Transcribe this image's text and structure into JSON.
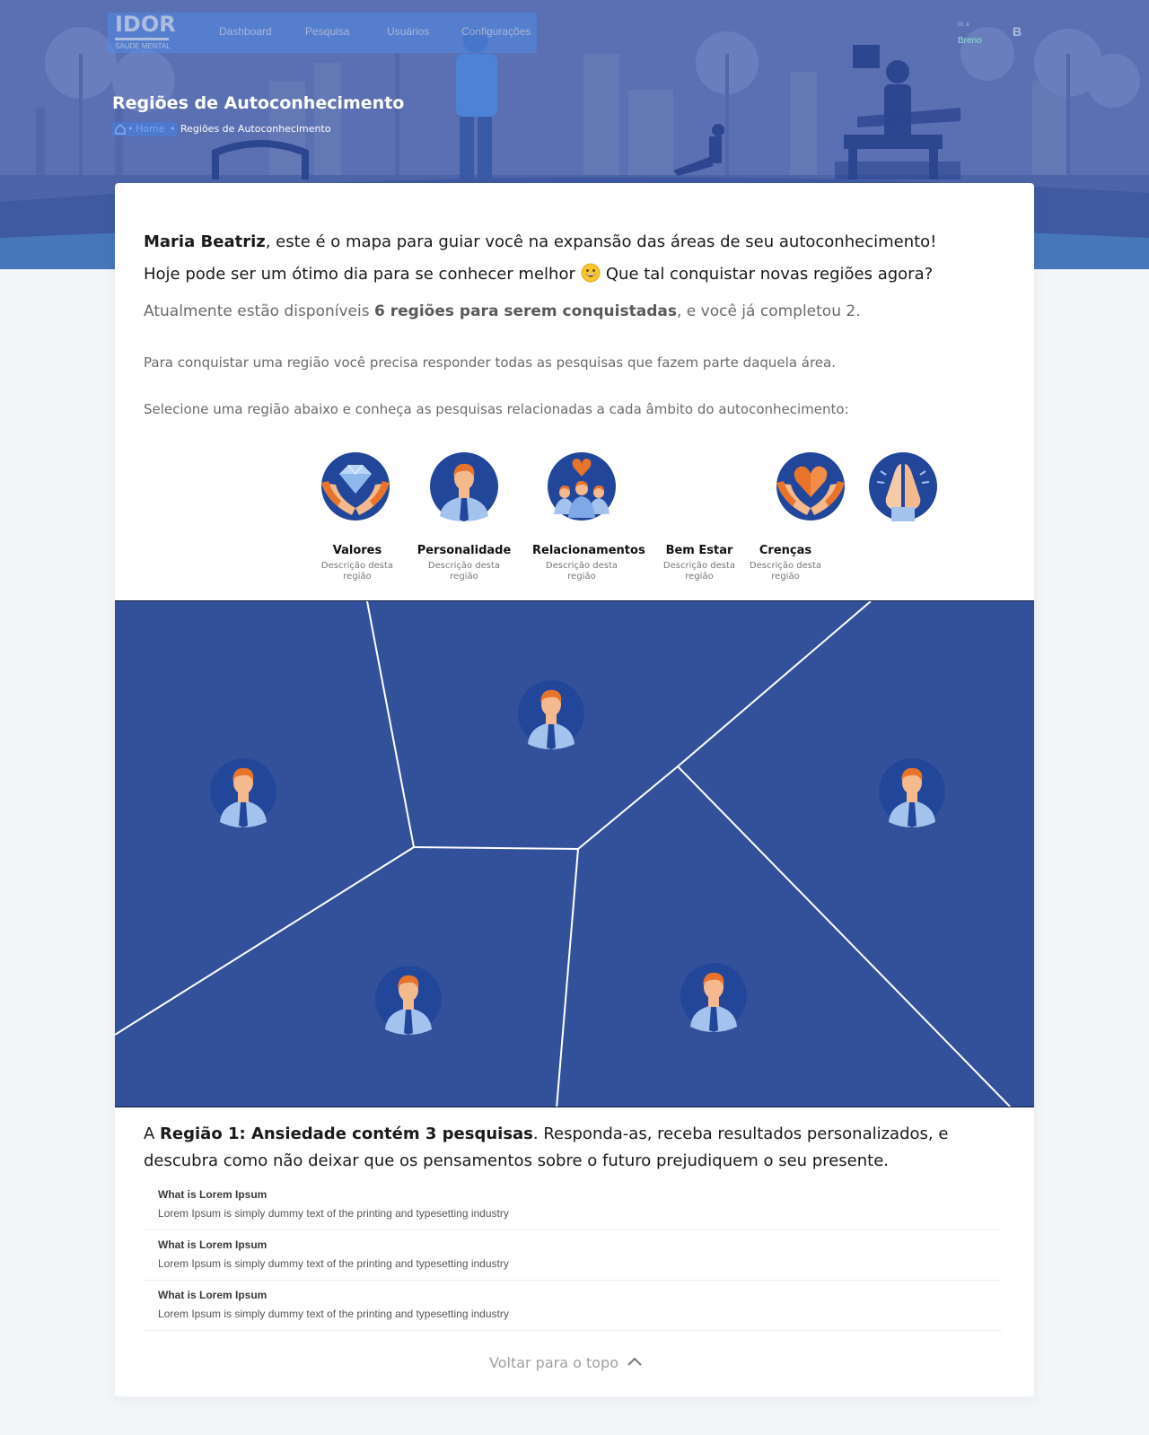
{
  "brand": {
    "logo": "IDOR",
    "subtitle": "SAUDE MENTAL"
  },
  "nav": {
    "items": [
      "Dashboard",
      "Pesquisa",
      "Usuários",
      "Configurações"
    ]
  },
  "user": {
    "greeting": "Oi, é",
    "name": "Breno",
    "initial": "B"
  },
  "page": {
    "title": "Regiões de Autoconhecimento",
    "breadcrumb": {
      "home": "Home",
      "current": "Regiões de Autoconhecimento"
    }
  },
  "intro": {
    "name": "Maria Beatriz",
    "line1_rest": ", este é o mapa para guiar você na expansão das áreas de seu autoconhecimento!",
    "line2_a": "Hoje pode ser um ótimo dia para se conhecer melhor",
    "line2_b": "Que tal conquistar novas regiões agora?",
    "available_a": "Atualmente estão disponíveis ",
    "available_bold": "6 regiões para serem conquistadas",
    "available_b": ", e você já completou 2.",
    "instruction1": "Para conquistar uma região você precisa responder todas as pesquisas que fazem parte daquela área.",
    "instruction2": "Selecione uma região abaixo e conheça as pesquisas relacionadas a cada âmbito do autoconhecimento:"
  },
  "regions": [
    {
      "name": "Valores",
      "desc": "Descrição desta região",
      "icon": "diamond-hands-icon"
    },
    {
      "name": "Personalidade",
      "desc": "Descrição desta região",
      "icon": "person-icon"
    },
    {
      "name": "Relacionamentos",
      "desc": "Descrição desta região",
      "icon": "group-heart-icon"
    },
    {
      "name": "Bem Estar",
      "desc": "Descrição desta região",
      "icon": "heart-hands-icon"
    },
    {
      "name": "Crenças",
      "desc": "Descrição desta região",
      "icon": "praying-hands-icon"
    }
  ],
  "map": {
    "fill": "#33519a",
    "line": "#ffffff",
    "markers": 5
  },
  "region_info": {
    "prefix": "A ",
    "bold": "Região 1: Ansiedade contém 3 pesquisas",
    "rest": ". Responda-as, receba resultados personalizados, e descubra como não deixar que os pensamentos sobre o futuro prejudiquem o seu presente."
  },
  "surveys": [
    {
      "title": "What is Lorem Ipsum",
      "desc": "Lorem Ipsum is simply dummy text of the printing and typesetting industry"
    },
    {
      "title": "What is Lorem Ipsum",
      "desc": "Lorem Ipsum is simply dummy text of the printing and typesetting industry"
    },
    {
      "title": "What is Lorem Ipsum",
      "desc": "Lorem Ipsum is simply dummy text of the printing and typesetting industry"
    }
  ],
  "back_to_top": "Voltar para o topo",
  "colors": {
    "hero": "#5a6fb0",
    "accent": "#2d4f9e",
    "orange": "#e8732a"
  }
}
